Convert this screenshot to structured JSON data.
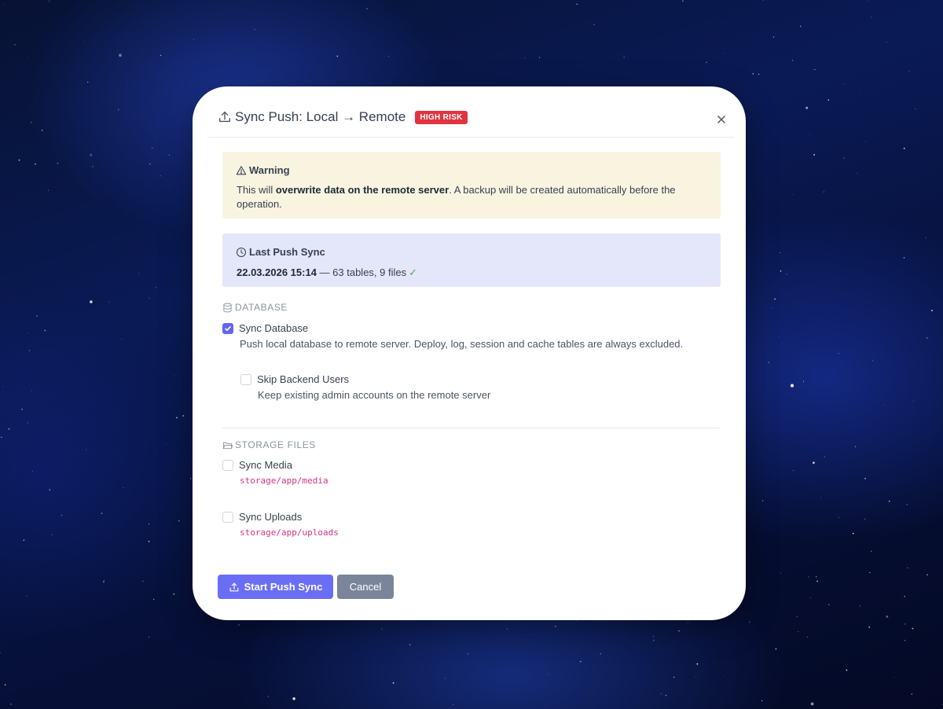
{
  "dialog": {
    "title": "Sync Push: Local → Remote",
    "badge": "HIGH RISK",
    "badge_color": "#e0343f",
    "title_icon": "upload-icon",
    "close_icon": "close-icon"
  },
  "warning": {
    "heading": "Warning",
    "icon": "warning-triangle-icon",
    "text_before": "This will ",
    "text_bold": "overwrite data on the remote server",
    "text_after": ". A backup will be created automatically before the operation."
  },
  "last_sync": {
    "heading": "Last Push Sync",
    "icon": "clock-icon",
    "datetime": "22.03.2026 15:14",
    "summary": " — 63 tables, 9 files",
    "status_icon": "check-icon"
  },
  "database": {
    "section_label": "DATABASE",
    "icon": "database-icon",
    "sync_database": {
      "label": "Sync Database",
      "checked": true,
      "description": "Push local database to remote server. Deploy, log, session and cache tables are always excluded."
    },
    "skip_backend_users": {
      "label": "Skip Backend Users",
      "checked": false,
      "description": "Keep existing admin accounts on the remote server"
    }
  },
  "storage": {
    "section_label": "STORAGE FILES",
    "icon": "folder-icon",
    "sync_media": {
      "label": "Sync Media",
      "checked": false,
      "path": "storage/app/media"
    },
    "sync_uploads": {
      "label": "Sync Uploads",
      "checked": false,
      "path": "storage/app/uploads"
    }
  },
  "actions": {
    "primary_label": "Start Push Sync",
    "primary_color": "#6b6ef5",
    "cancel_label": "Cancel",
    "cancel_color": "#7b8599"
  }
}
